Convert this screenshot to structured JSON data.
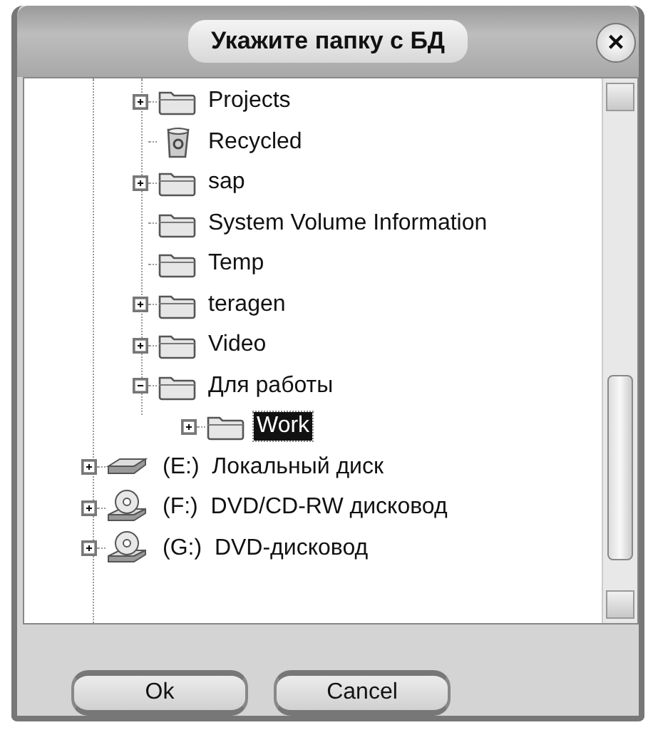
{
  "window": {
    "title": "Укажите папку с БД",
    "close": "×"
  },
  "tree": {
    "folders": [
      {
        "label": "Projects",
        "kind": "folder",
        "expandable": true,
        "expanded": false,
        "selected": false
      },
      {
        "label": "Recycled",
        "kind": "recycle",
        "expandable": false,
        "selected": false
      },
      {
        "label": "sap",
        "kind": "folder",
        "expandable": true,
        "expanded": false,
        "selected": false
      },
      {
        "label": "System Volume Information",
        "kind": "folder",
        "expandable": false,
        "selected": false
      },
      {
        "label": "Temp",
        "kind": "folder",
        "expandable": false,
        "selected": false
      },
      {
        "label": "teragen",
        "kind": "folder",
        "expandable": true,
        "expanded": false,
        "selected": false
      },
      {
        "label": "Video",
        "kind": "folder",
        "expandable": true,
        "expanded": false,
        "selected": false
      },
      {
        "label": "Для работы",
        "kind": "folder",
        "expandable": true,
        "expanded": true,
        "selected": false,
        "children": [
          {
            "label": "Work",
            "kind": "folder",
            "expandable": true,
            "expanded": false,
            "selected": true
          }
        ]
      }
    ],
    "drives": [
      {
        "label": "(E:)  Локальный диск",
        "kind": "drive",
        "expandable": true,
        "expanded": false,
        "selected": false
      },
      {
        "label": "(F:)  DVD/CD-RW дисковод",
        "kind": "cdrom",
        "expandable": true,
        "expanded": false,
        "selected": false
      },
      {
        "label": "(G:)  DVD-дисковод",
        "kind": "cdrom",
        "expandable": true,
        "expanded": false,
        "selected": false
      }
    ]
  },
  "buttons": [
    {
      "label": "Ok"
    },
    {
      "label": "Cancel"
    }
  ]
}
